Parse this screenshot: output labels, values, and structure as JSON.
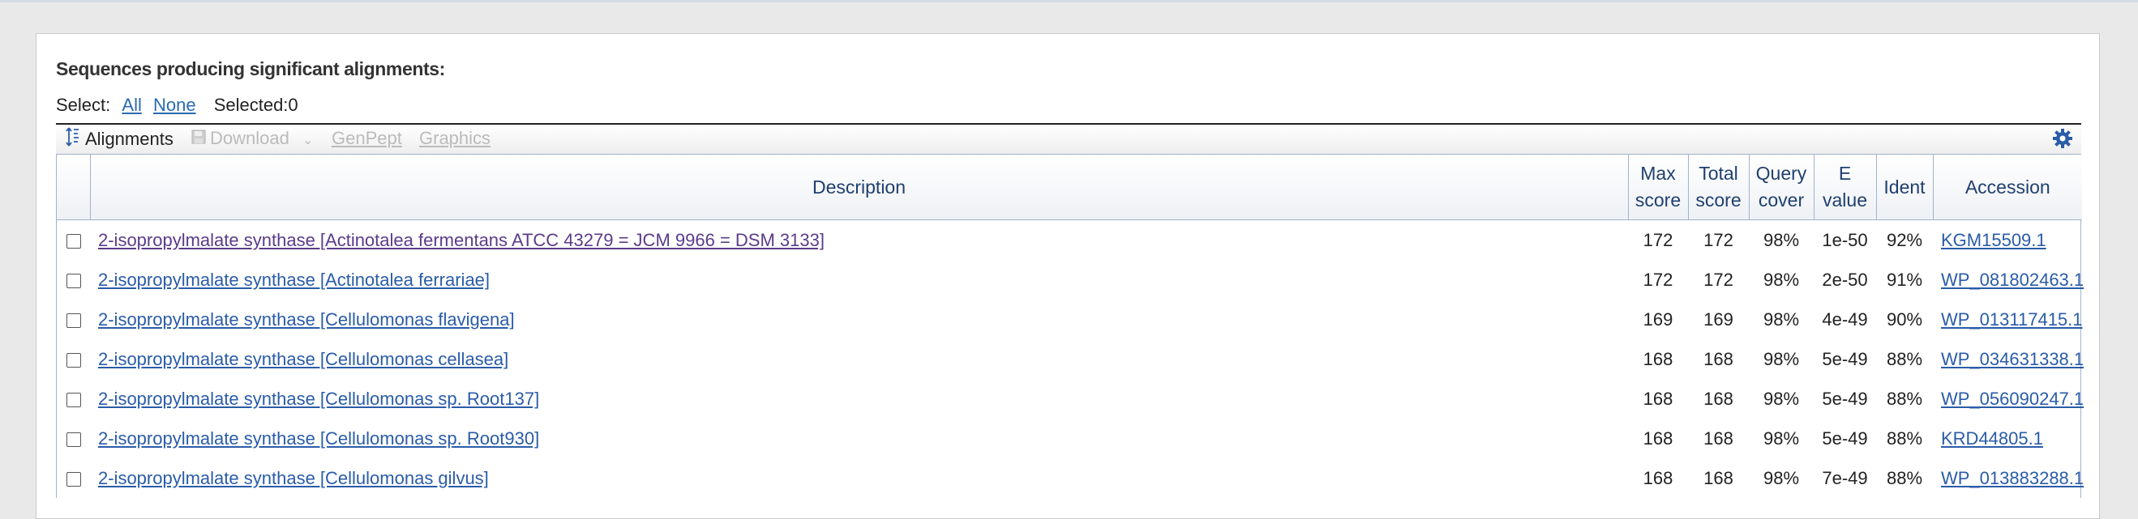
{
  "heading": "Sequences producing significant alignments:",
  "select": {
    "label": "Select:",
    "all": "All",
    "none": "None",
    "selected": "Selected:0"
  },
  "toolbar": {
    "alignments": "Alignments",
    "download": "Download",
    "genpept": "GenPept",
    "graphics": "Graphics",
    "gear_icon": "gear-icon"
  },
  "columns": {
    "description": "Description",
    "max_score": [
      "Max",
      "score"
    ],
    "total_score": [
      "Total",
      "score"
    ],
    "query_cover": [
      "Query",
      "cover"
    ],
    "e_value": [
      "E",
      "value"
    ],
    "ident": "Ident",
    "accession": "Accession"
  },
  "rows": [
    {
      "description": "2-isopropylmalate synthase [Actinotalea fermentans ATCC 43279 = JCM 9966 = DSM 3133]",
      "max_score": "172",
      "total_score": "172",
      "query_cover": "98%",
      "e_value": "1e-50",
      "ident": "92%",
      "accession": "KGM15509.1"
    },
    {
      "description": "2-isopropylmalate synthase [Actinotalea ferrariae]",
      "max_score": "172",
      "total_score": "172",
      "query_cover": "98%",
      "e_value": "2e-50",
      "ident": "91%",
      "accession": "WP_081802463.1"
    },
    {
      "description": "2-isopropylmalate synthase [Cellulomonas flavigena]",
      "max_score": "169",
      "total_score": "169",
      "query_cover": "98%",
      "e_value": "4e-49",
      "ident": "90%",
      "accession": "WP_013117415.1"
    },
    {
      "description": "2-isopropylmalate synthase [Cellulomonas cellasea]",
      "max_score": "168",
      "total_score": "168",
      "query_cover": "98%",
      "e_value": "5e-49",
      "ident": "88%",
      "accession": "WP_034631338.1"
    },
    {
      "description": "2-isopropylmalate synthase [Cellulomonas sp. Root137]",
      "max_score": "168",
      "total_score": "168",
      "query_cover": "98%",
      "e_value": "5e-49",
      "ident": "88%",
      "accession": "WP_056090247.1"
    },
    {
      "description": "2-isopropylmalate synthase [Cellulomonas sp. Root930]",
      "max_score": "168",
      "total_score": "168",
      "query_cover": "98%",
      "e_value": "5e-49",
      "ident": "88%",
      "accession": "KRD44805.1"
    },
    {
      "description": "2-isopropylmalate synthase [Cellulomonas gilvus]",
      "max_score": "168",
      "total_score": "168",
      "query_cover": "98%",
      "e_value": "7e-49",
      "ident": "88%",
      "accession": "WP_013883288.1"
    }
  ]
}
